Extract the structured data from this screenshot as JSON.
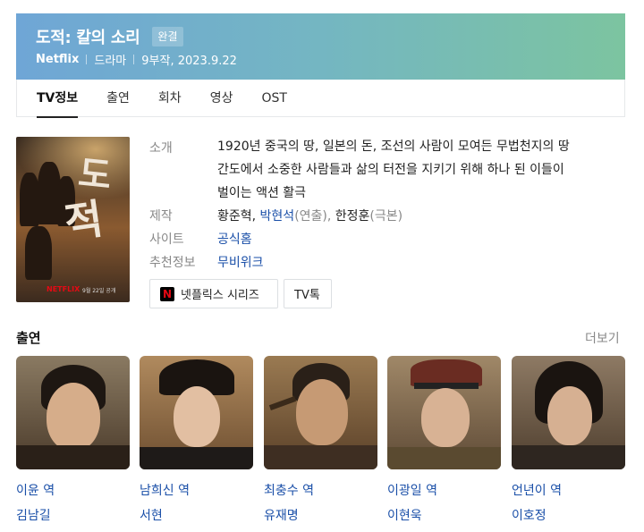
{
  "header": {
    "title": "도적: 칼의 소리",
    "badge": "완결",
    "network": "Netflix",
    "genre": "드라마",
    "episodes_date": "9부작, 2023.9.22"
  },
  "tabs": [
    {
      "label": "TV정보",
      "active": true
    },
    {
      "label": "출연",
      "active": false
    },
    {
      "label": "회차",
      "active": false
    },
    {
      "label": "영상",
      "active": false
    },
    {
      "label": "OST",
      "active": false
    }
  ],
  "poster": {
    "title_chars": [
      "도",
      "적"
    ],
    "network_mark": "NETFLIX",
    "date_mark": "9월 22일 공개"
  },
  "info": {
    "intro_label": "소개",
    "intro_line1": "1920년 중국의 땅, 일본의 돈, 조선의 사람이 모여든 무법천지의 땅",
    "intro_line2": "간도에서 소중한 사람들과 삶의 터전을 지키기 위해 하나 된 이들이",
    "intro_line3": "벌이는 액션 활극",
    "production_label": "제작",
    "producer1": "황준혁",
    "producer_sep": ",",
    "producer2": "박현석",
    "producer2_role": "(연출),",
    "producer3": "한정훈",
    "producer3_role": "(극본)",
    "site_label": "사이트",
    "site_value": "공식홈",
    "recommend_label": "추천정보",
    "recommend_value": "무비위크"
  },
  "chips": {
    "netflix_icon_letter": "N",
    "netflix_series": "넷플릭스 시리즈",
    "tv_talk": "TV톡"
  },
  "cast_section": {
    "title": "출연",
    "more": "더보기",
    "members": [
      {
        "role": "이윤 역",
        "actor": "김남길"
      },
      {
        "role": "남희신 역",
        "actor": "서현"
      },
      {
        "role": "최충수 역",
        "actor": "유재명"
      },
      {
        "role": "이광일 역",
        "actor": "이현욱"
      },
      {
        "role": "언년이 역",
        "actor": "이호정"
      }
    ]
  },
  "colors": {
    "banner_left": "#6fa6d6",
    "banner_right": "#7cc4a0",
    "link": "#1a4fa8",
    "netflix_red": "#e50914"
  }
}
